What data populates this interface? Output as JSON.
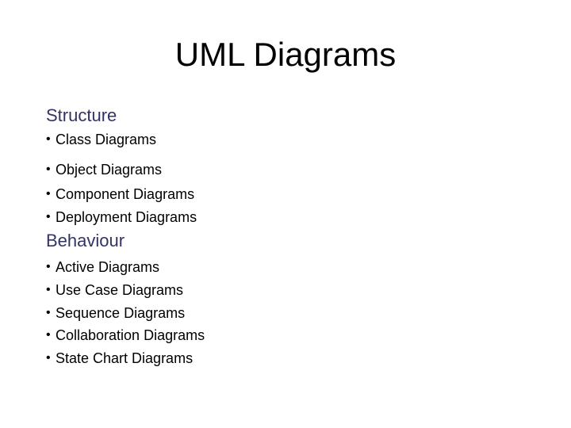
{
  "title": "UML Diagrams",
  "sections": [
    {
      "heading": "Structure",
      "items": [
        "Class Diagrams",
        "Object Diagrams",
        "Component Diagrams",
        "Deployment Diagrams"
      ]
    },
    {
      "heading": "Behaviour",
      "items": [
        "Active Diagrams",
        "Use Case Diagrams",
        "Sequence Diagrams",
        "Collaboration Diagrams",
        "State Chart Diagrams"
      ]
    }
  ],
  "bullet_glyph": "•",
  "colors": {
    "heading": "#333366",
    "text": "#000000"
  }
}
